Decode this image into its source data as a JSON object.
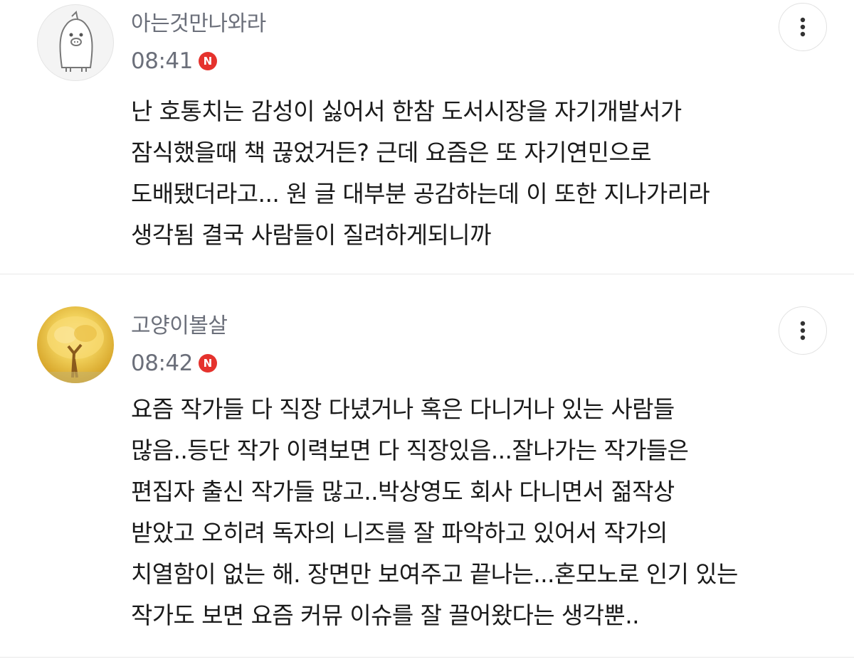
{
  "comments": [
    {
      "nickname": "아는것만나와라",
      "time": "08:41",
      "badge": "N",
      "avatar_icon": "penguin-avatar-icon",
      "text": "난 호통치는 감성이 싫어서 한참 도서시장을 자기개발서가\n잠식했을때 책 끊었거든? 근데 요즘은 또 자기연민으로\n도배됐더라고... 원 글 대부분 공감하는데 이 또한 지나가리라\n생각됨 결국 사람들이 질려하게되니까"
    },
    {
      "nickname": "고양이볼살",
      "time": "08:42",
      "badge": "N",
      "avatar_icon": "golden-tree-avatar-icon",
      "text": "요즘 작가들 다 직장 다녔거나 혹은 다니거나 있는 사람들\n많음..등단 작가 이력보면 다 직장있음...잘나가는 작가들은\n편집자 출신 작가들 많고..박상영도 회사 다니면서 젊작상\n받았고 오히려 독자의 니즈를 잘 파악하고 있어서 작가의\n치열함이 없는 해. 장면만 보여주고 끝나는...혼모노로 인기 있는\n작가도 보면 요즘 커뮤 이슈를 잘 끌어왔다는 생각뿐.."
    }
  ],
  "colors": {
    "badge_red": "#e5322d",
    "meta_gray": "#6b6f7a",
    "divider": "#e8e8e8"
  }
}
